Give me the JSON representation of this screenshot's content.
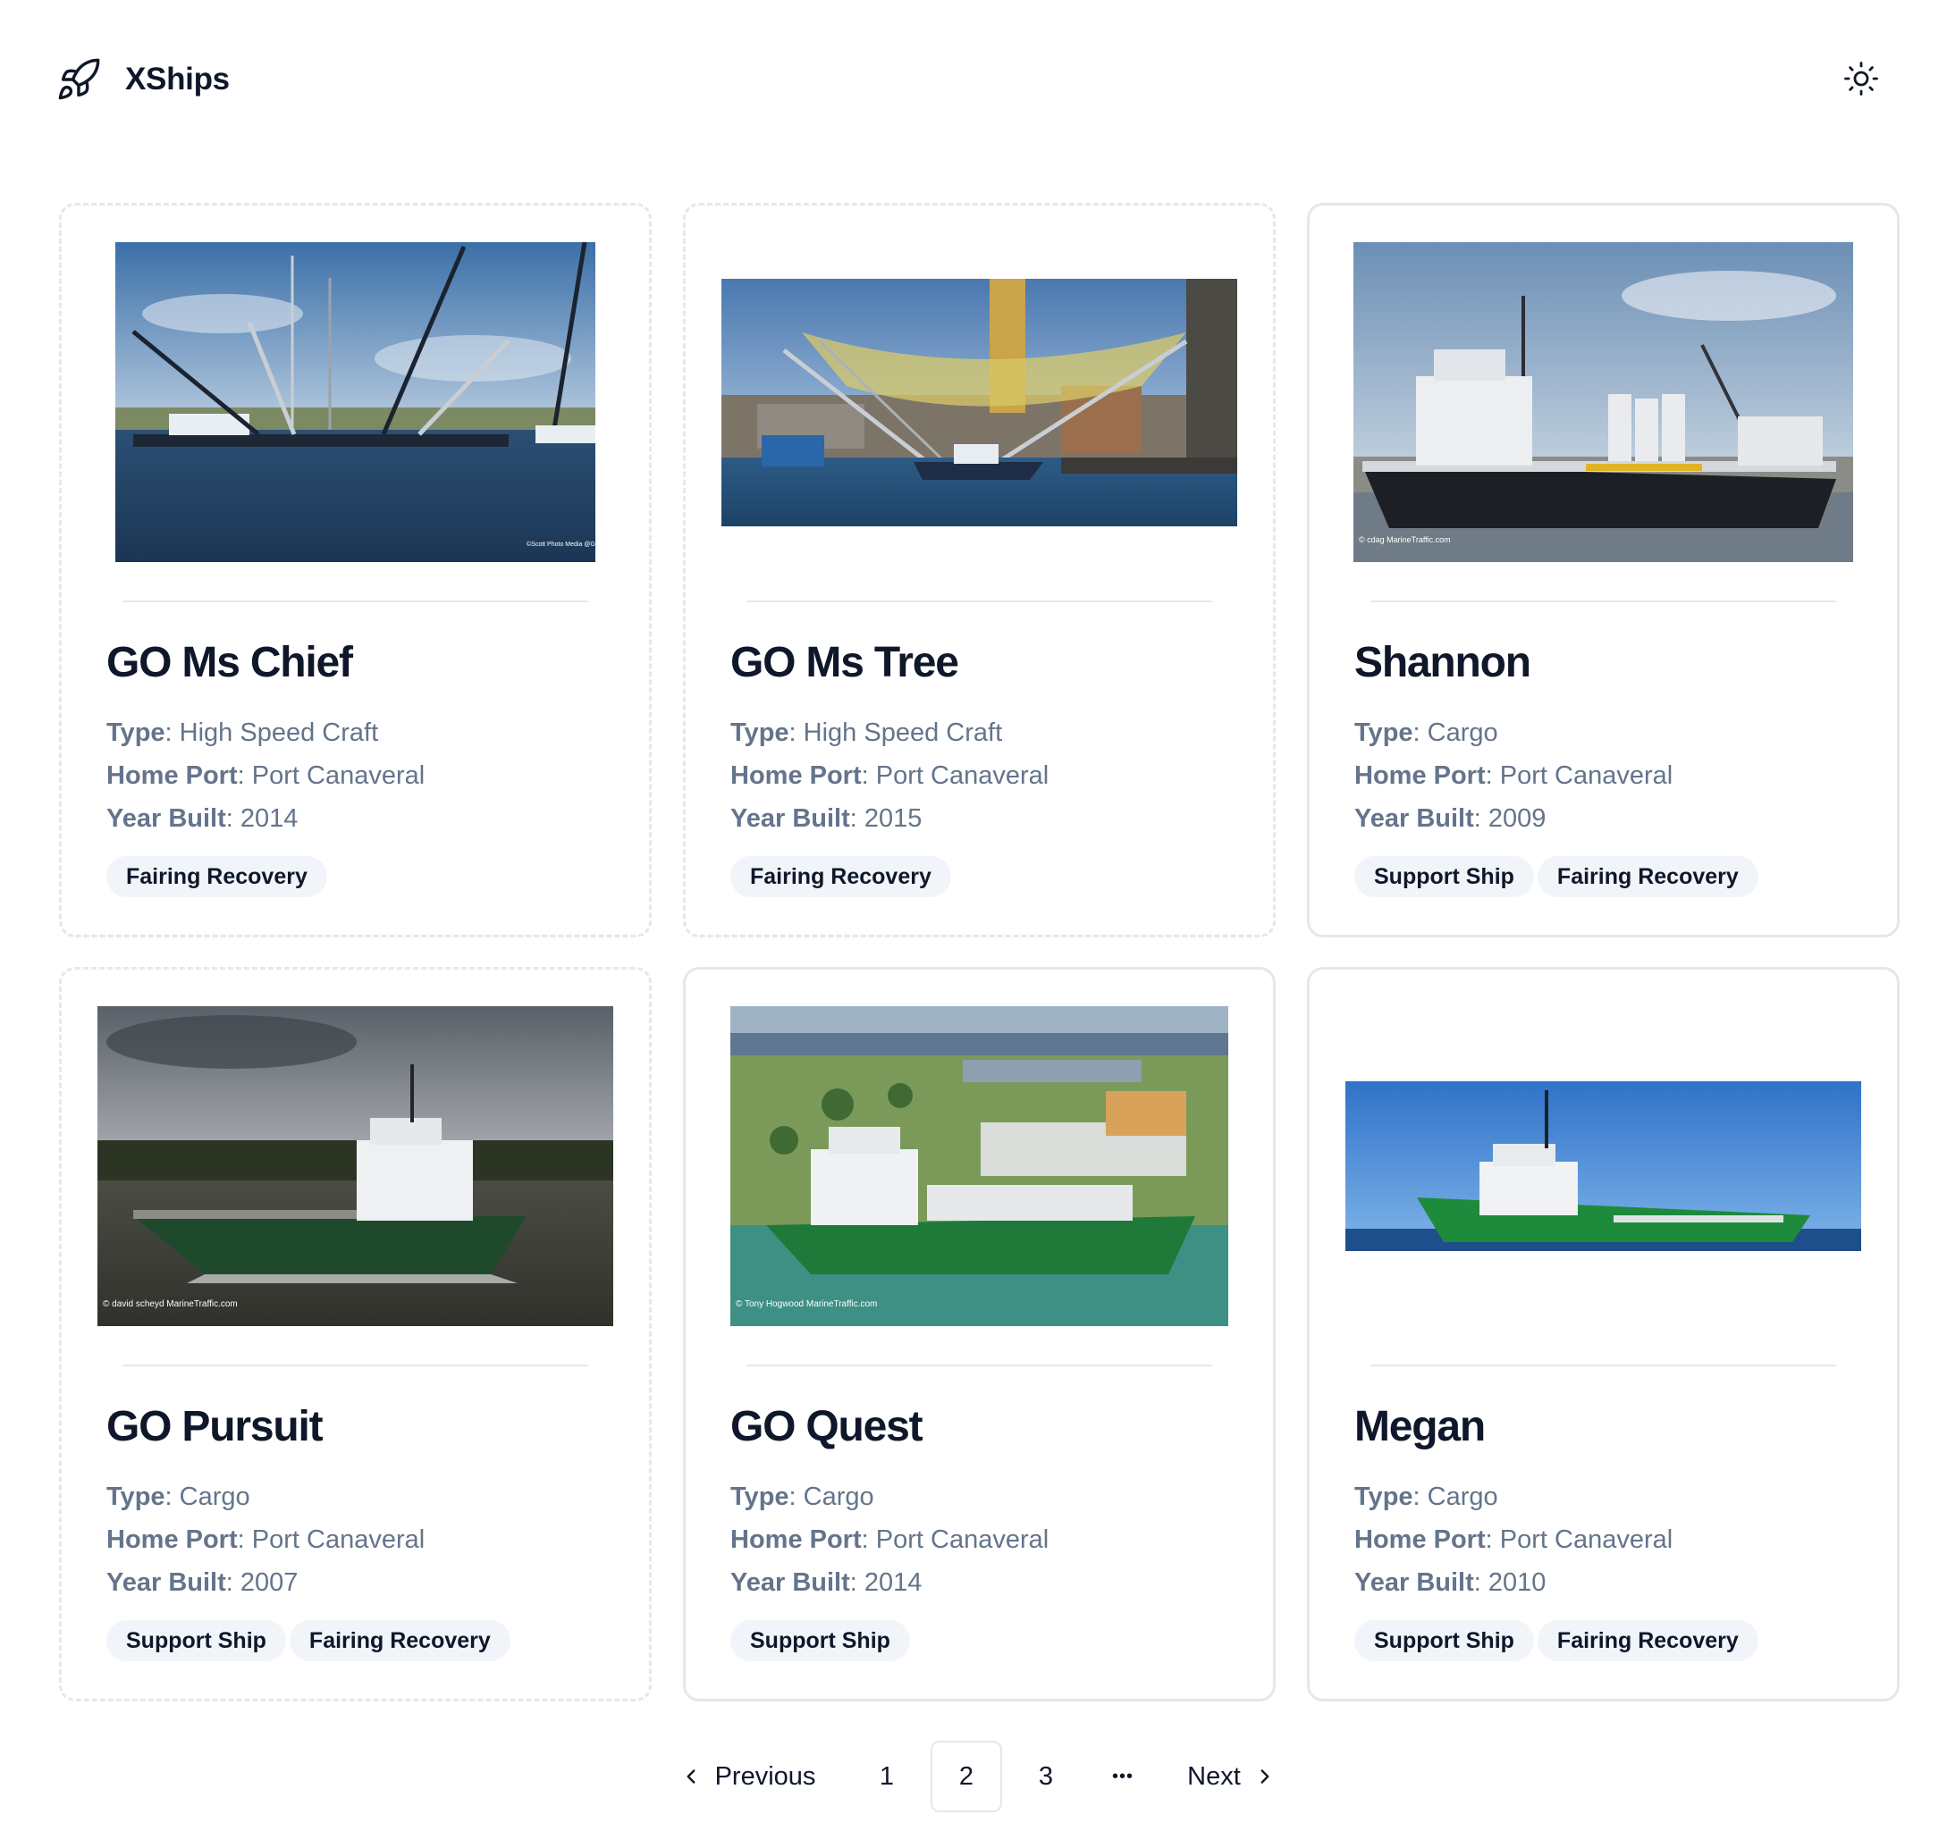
{
  "header": {
    "app_title": "XShips",
    "logo_icon": "rocket-icon",
    "theme_toggle_icon": "sun-icon"
  },
  "ships": [
    {
      "name": "GO Ms Chief",
      "type_label": "Type",
      "type": "High Speed Craft",
      "port_label": "Home Port",
      "port": "Port Canaveral",
      "year_label": "Year Built",
      "year": "2014",
      "tags": [
        "Fairing Recovery"
      ],
      "photo_credit": "©Scott Photo Media @Greybeard_photo"
    },
    {
      "name": "GO Ms Tree",
      "type_label": "Type",
      "type": "High Speed Craft",
      "port_label": "Home Port",
      "port": "Port Canaveral",
      "year_label": "Year Built",
      "year": "2015",
      "tags": [
        "Fairing Recovery"
      ],
      "photo_credit": ""
    },
    {
      "name": "Shannon",
      "type_label": "Type",
      "type": "Cargo",
      "port_label": "Home Port",
      "port": "Port Canaveral",
      "year_label": "Year Built",
      "year": "2009",
      "tags": [
        "Support Ship",
        "Fairing Recovery"
      ],
      "photo_credit": "© cdag MarineTraffic.com"
    },
    {
      "name": "GO Pursuit",
      "type_label": "Type",
      "type": "Cargo",
      "port_label": "Home Port",
      "port": "Port Canaveral",
      "year_label": "Year Built",
      "year": "2007",
      "tags": [
        "Support Ship",
        "Fairing Recovery"
      ],
      "photo_credit": "© david scheyd MarineTraffic.com"
    },
    {
      "name": "GO Quest",
      "type_label": "Type",
      "type": "Cargo",
      "port_label": "Home Port",
      "port": "Port Canaveral",
      "year_label": "Year Built",
      "year": "2014",
      "tags": [
        "Support Ship"
      ],
      "photo_credit": "© Tony Hogwood MarineTraffic.com"
    },
    {
      "name": "Megan",
      "type_label": "Type",
      "type": "Cargo",
      "port_label": "Home Port",
      "port": "Port Canaveral",
      "year_label": "Year Built",
      "year": "2010",
      "tags": [
        "Support Ship",
        "Fairing Recovery"
      ],
      "photo_credit": ""
    }
  ],
  "pagination": {
    "previous": "Previous",
    "next": "Next",
    "pages": [
      "1",
      "2",
      "3"
    ],
    "current": "2",
    "ellipsis": "•••"
  },
  "colors": {
    "text": "#0f172a",
    "muted": "#64748b",
    "border": "#e2e8f0",
    "tag_bg": "#f1f5f9"
  }
}
